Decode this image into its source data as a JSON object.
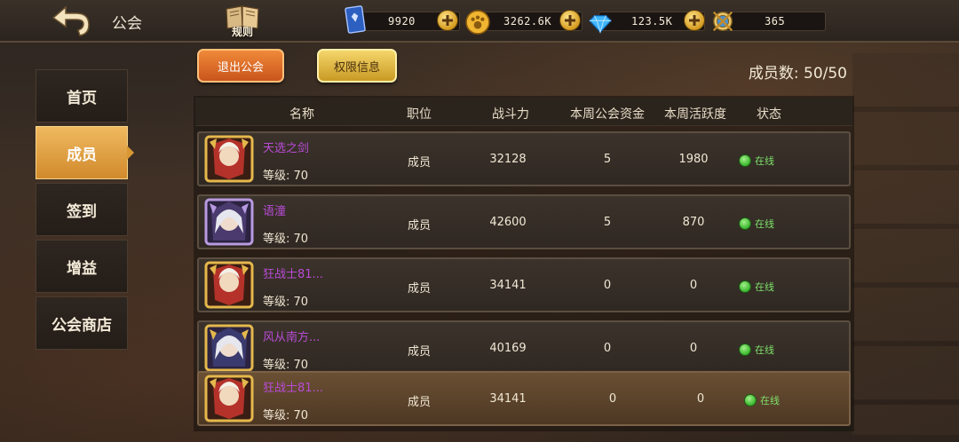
{
  "header": {
    "title": "公会",
    "rules_label": "规则",
    "resources": [
      {
        "name": "card",
        "icon": "card-icon",
        "value": "9920"
      },
      {
        "name": "coin",
        "icon": "paw-coin-icon",
        "value": "3262.6K"
      },
      {
        "name": "diamond",
        "icon": "diamond-icon",
        "value": "123.5K"
      },
      {
        "name": "energy",
        "icon": "compass-icon",
        "value": "365"
      }
    ]
  },
  "nav": {
    "items": [
      {
        "label": "首页",
        "active": false
      },
      {
        "label": "成员",
        "active": true
      },
      {
        "label": "签到",
        "active": false
      },
      {
        "label": "增益",
        "active": false
      },
      {
        "label": "公会商店",
        "active": false
      }
    ]
  },
  "actions": {
    "leave_label": "退出公会",
    "permissions_label": "权限信息",
    "member_count": "成员数: 50/50"
  },
  "table": {
    "headers": [
      "名称",
      "职位",
      "战斗力",
      "本周公会资金",
      "本周活跃度",
      "状态"
    ],
    "rows": [
      {
        "name": "天选之剑",
        "level": "等级: 70",
        "role": "成员",
        "power": "32128",
        "funds": "5",
        "activity": "1980",
        "status": "在线",
        "avatar": "golden-knight-avatar"
      },
      {
        "name": "语潼",
        "level": "等级: 70",
        "role": "成员",
        "power": "42600",
        "funds": "5",
        "activity": "870",
        "status": "在线",
        "avatar": "silver-hair-avatar"
      },
      {
        "name": "狂战士81...",
        "level": "等级: 70",
        "role": "成员",
        "power": "34141",
        "funds": "0",
        "activity": "0",
        "status": "在线",
        "avatar": "golden-knight-avatar"
      },
      {
        "name": "风从南方...",
        "level": "等级: 70",
        "role": "成员",
        "power": "40169",
        "funds": "0",
        "activity": "0",
        "status": "在线",
        "avatar": "silver-hair-avatar"
      },
      {
        "name": "狂战士81...",
        "level": "等级: 70",
        "role": "成员",
        "power": "34141",
        "funds": "0",
        "activity": "0",
        "status": "在线",
        "avatar": "golden-knight-avatar"
      }
    ]
  },
  "colors": {
    "active_tab": "#d99734",
    "name_purple": "#b94bd6",
    "online_green": "#7ee06a",
    "leave_button": "#e06a2a",
    "permissions_button": "#e0b844"
  }
}
